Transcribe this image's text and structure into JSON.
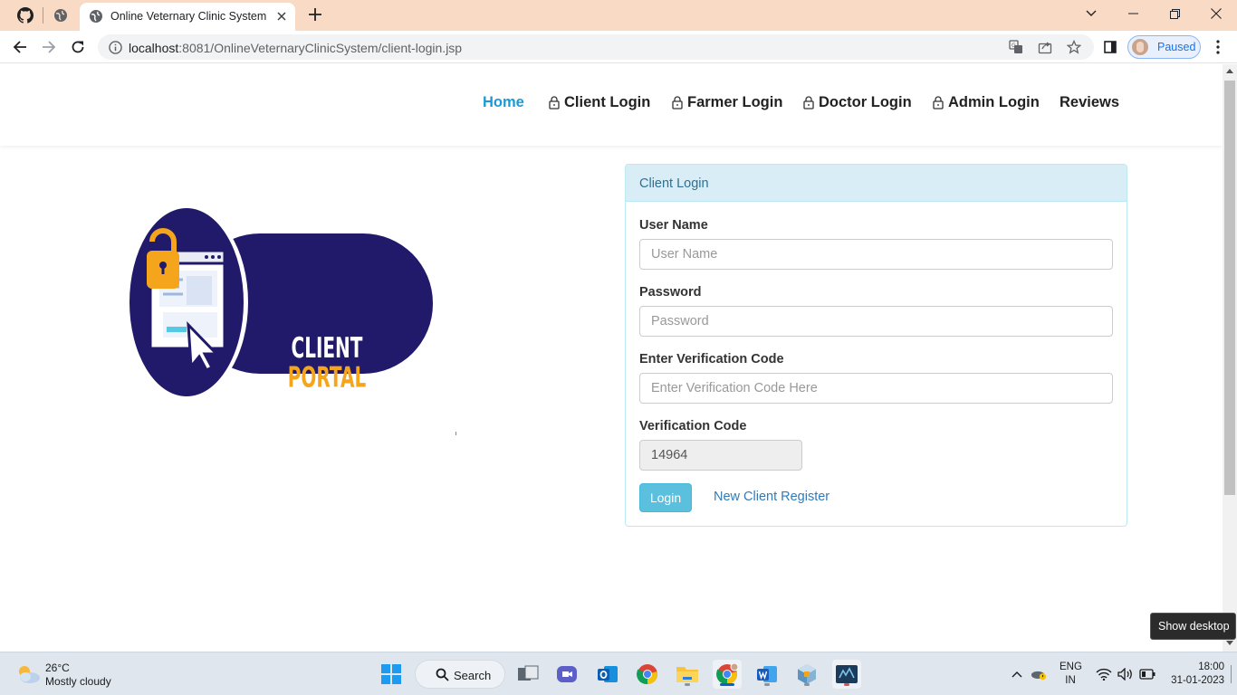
{
  "browser": {
    "tab_title": "Online Veternary Clinic System",
    "url_host": "localhost",
    "url_rest": ":8081/OnlineVeternaryClinicSystem/client-login.jsp",
    "profile_status": "Paused"
  },
  "site_nav": {
    "items": [
      {
        "label": "Home",
        "active": true,
        "locked": false
      },
      {
        "label": "Client Login",
        "locked": true
      },
      {
        "label": "Farmer Login",
        "locked": true
      },
      {
        "label": "Doctor Login",
        "locked": true
      },
      {
        "label": "Admin Login",
        "locked": true
      },
      {
        "label": "Reviews",
        "locked": false
      }
    ]
  },
  "logo": {
    "line1": "CLIENT",
    "line2": "PORTAL",
    "colors": {
      "navy": "#211a6b",
      "gold": "#f5a51b"
    }
  },
  "login_panel": {
    "heading": "Client Login",
    "username_label": "User Name",
    "username_placeholder": "User Name",
    "password_label": "Password",
    "password_placeholder": "Password",
    "verify_input_label": "Enter Verification Code",
    "verify_input_placeholder": "Enter Verification Code Here",
    "verify_code_label": "Verification Code",
    "verify_code_value": "14964",
    "login_button": "Login",
    "register_link": "New Client Register"
  },
  "taskbar": {
    "weather_temp": "26°C",
    "weather_desc": "Mostly cloudy",
    "search_label": "Search",
    "lang_line1": "ENG",
    "lang_line2": "IN",
    "time": "18:00",
    "date": "31-01-2023"
  },
  "tooltip": "Show desktop",
  "colors": {
    "tabbar": "#f9dac4",
    "nav_active": "#1a9ad6",
    "panel_head": "#d9edf7",
    "login_btn": "#5bc0de",
    "link": "#337ab7"
  }
}
